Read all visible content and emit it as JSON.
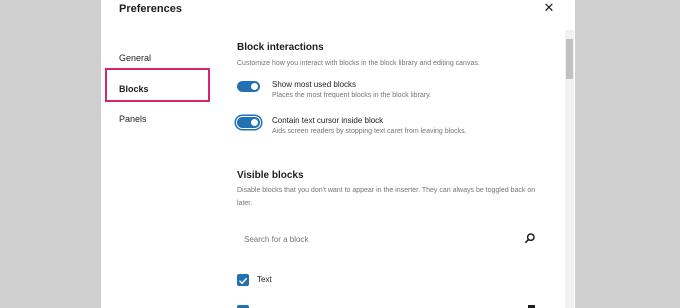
{
  "dialog": {
    "title": "Preferences",
    "close_icon": "close-icon"
  },
  "nav": {
    "items": [
      {
        "label": "General"
      },
      {
        "label": "Blocks",
        "active": true
      },
      {
        "label": "Panels"
      }
    ]
  },
  "block_interactions": {
    "title": "Block interactions",
    "description": "Customize how you interact with blocks in the block library and editing canvas.",
    "toggles": [
      {
        "label": "Show most used blocks",
        "help": "Places the most frequent blocks in the block library.",
        "checked": true
      },
      {
        "label": "Contain text cursor inside block",
        "help": "Aids screen readers by stopping text caret from leaving blocks.",
        "checked": true
      }
    ]
  },
  "visible_blocks": {
    "title": "Visible blocks",
    "description": "Disable blocks that you don't want to appear in the inserter. They can always be toggled back on later.",
    "search_placeholder": "Search for a block",
    "search_icon": "search-icon",
    "categories": [
      {
        "label": "Text",
        "checked": true
      }
    ]
  },
  "colors": {
    "accent": "#2271b1",
    "highlight": "#d6246e"
  }
}
